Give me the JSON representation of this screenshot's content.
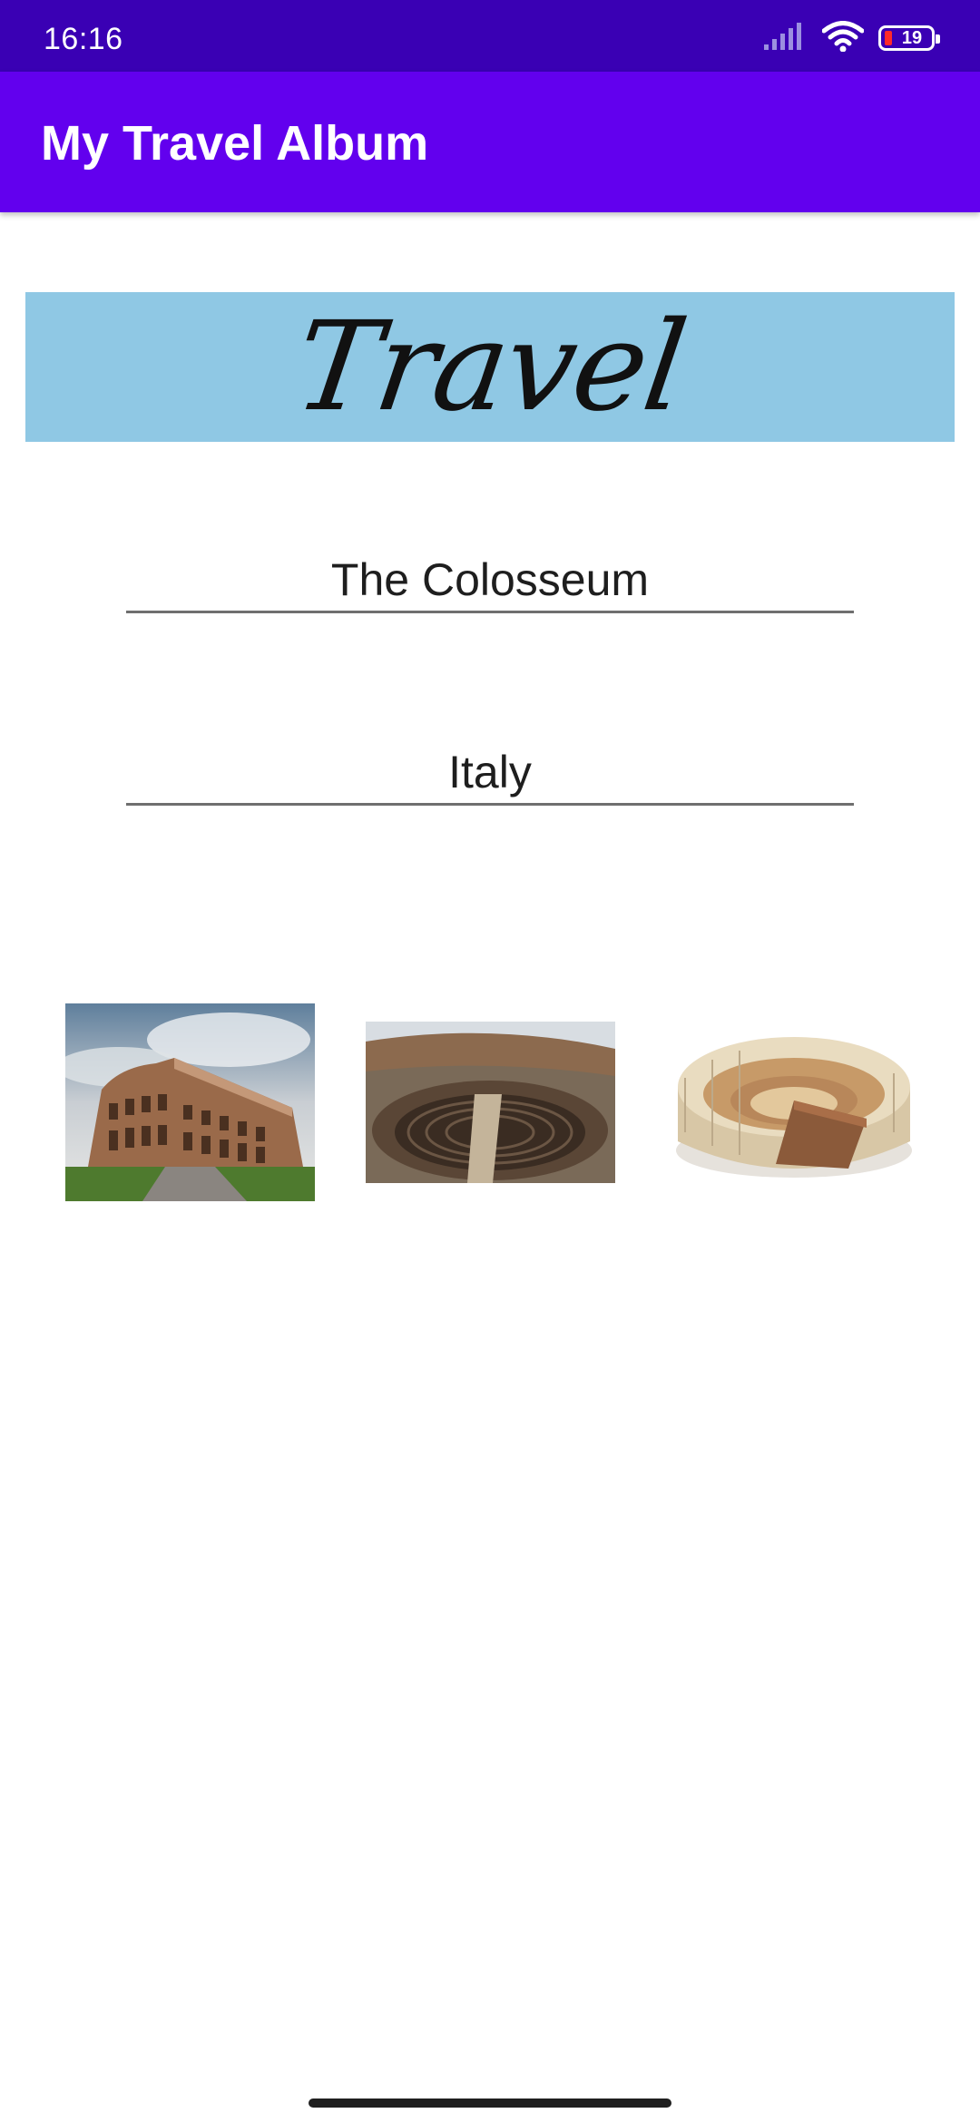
{
  "status_bar": {
    "time": "16:16",
    "battery": "19",
    "icons": [
      "signal-icon",
      "wifi-icon",
      "battery-icon"
    ]
  },
  "app_bar": {
    "title": "My Travel Album"
  },
  "banner": {
    "text": "Travel",
    "background": "#8fc8e4"
  },
  "form": {
    "place_name": "The Colosseum",
    "country": "Italy"
  },
  "gallery": {
    "images": [
      {
        "name": "colosseum-exterior-photo"
      },
      {
        "name": "colosseum-interior-photo"
      },
      {
        "name": "colosseum-3d-model-image"
      }
    ]
  },
  "colors": {
    "status_bar": "#3a00b4",
    "app_bar": "#6200ee"
  }
}
